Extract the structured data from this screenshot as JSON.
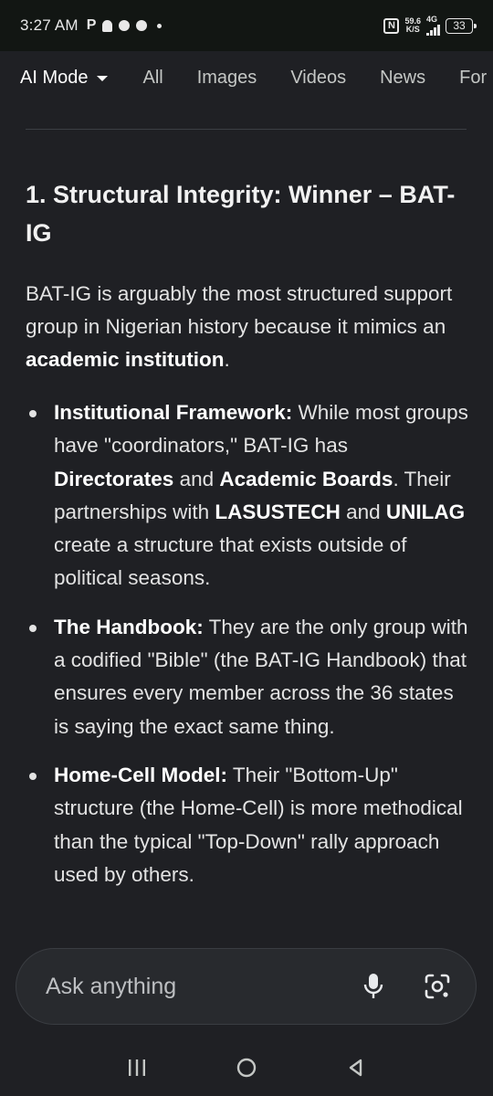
{
  "status_bar": {
    "time": "3:27 AM",
    "p_icon_label": "P",
    "network_speed_value": "59.6",
    "network_speed_unit": "K/S",
    "network_type": "4G",
    "battery_level": "33"
  },
  "tabs": {
    "active_label": "AI Mode",
    "items": [
      "All",
      "Images",
      "Videos",
      "News",
      "For"
    ]
  },
  "content": {
    "heading": "1. Structural Integrity: Winner – BAT-IG",
    "intro": {
      "text_before": "BAT-IG is arguably the most structured support group in Nigerian history because it mimics an ",
      "bold": "academic institution",
      "text_after": "."
    },
    "bullets": [
      {
        "segments": [
          {
            "bold": true,
            "text": "Institutional Framework:"
          },
          {
            "bold": false,
            "text": " While most groups have \"coordinators,\" BAT-IG has "
          },
          {
            "bold": true,
            "text": "Directorates"
          },
          {
            "bold": false,
            "text": " and "
          },
          {
            "bold": true,
            "text": "Academic Boards"
          },
          {
            "bold": false,
            "text": ". Their partnerships with "
          },
          {
            "bold": true,
            "text": "LASUSTECH"
          },
          {
            "bold": false,
            "text": " and "
          },
          {
            "bold": true,
            "text": "UNILAG"
          },
          {
            "bold": false,
            "text": " create a structure that exists outside of political seasons."
          }
        ]
      },
      {
        "segments": [
          {
            "bold": true,
            "text": "The Handbook:"
          },
          {
            "bold": false,
            "text": " They are the only group with a codified \"Bible\" (the BAT-IG Handbook) that ensures every member across the 36 states is saying the exact same thing."
          }
        ]
      },
      {
        "segments": [
          {
            "bold": true,
            "text": "Home-Cell Model:"
          },
          {
            "bold": false,
            "text": " Their \"Bottom-Up\" structure (the Home-Cell) is more methodical than the typical \"Top-Down\" rally approach used by others."
          }
        ]
      }
    ]
  },
  "ask_bar": {
    "placeholder": "Ask anything",
    "mic_icon": "microphone-icon",
    "lens_icon": "google-lens-icon"
  },
  "nav_bar": {
    "icons": [
      "recents-icon",
      "home-icon",
      "back-icon"
    ]
  },
  "colors": {
    "background": "#1f2024",
    "status_bar_bg": "#121613",
    "text": "#e3e3e3",
    "ask_bar_bg": "#282a2e"
  }
}
